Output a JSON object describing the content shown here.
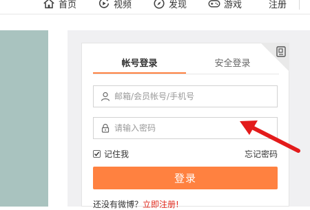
{
  "nav": {
    "home": "首页",
    "video": "视频",
    "discover": "发现",
    "games": "游戏",
    "register": "注册"
  },
  "login": {
    "tabs": [
      "帐号登录",
      "安全登录"
    ],
    "username": {
      "placeholder": "邮箱/会员帐号/手机号",
      "value": ""
    },
    "password": {
      "placeholder": "请输入密码",
      "value": ""
    },
    "remember_label": "记住我",
    "remember_checked": true,
    "forgot_label": "忘记密码",
    "submit_label": "登录",
    "no_account_text": "还没有微博？",
    "register_link": "立即注册!"
  },
  "icons": {
    "home": "home-icon",
    "video": "video-play-icon",
    "discover": "compass-icon",
    "games": "gamepad-icon",
    "user": "user-icon",
    "lock": "lock-icon",
    "qr": "qr-code-icon",
    "annotation": "red-arrow-icon"
  },
  "colors": {
    "accent": "#ff8140",
    "link_red": "#e02a1d",
    "annotation_arrow": "#e31b1b",
    "banner": "#a9c3bf"
  }
}
